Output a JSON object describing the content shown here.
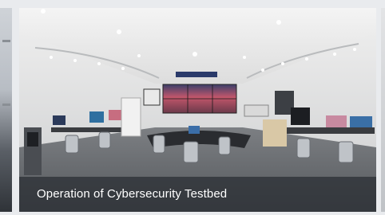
{
  "slide": {
    "caption": "Operation of Cybersecurity Testbed",
    "sign_text": "",
    "colors": {
      "caption_bg": "#2c3036",
      "caption_text": "#ffffff",
      "video_wall": "#c2566b"
    }
  }
}
